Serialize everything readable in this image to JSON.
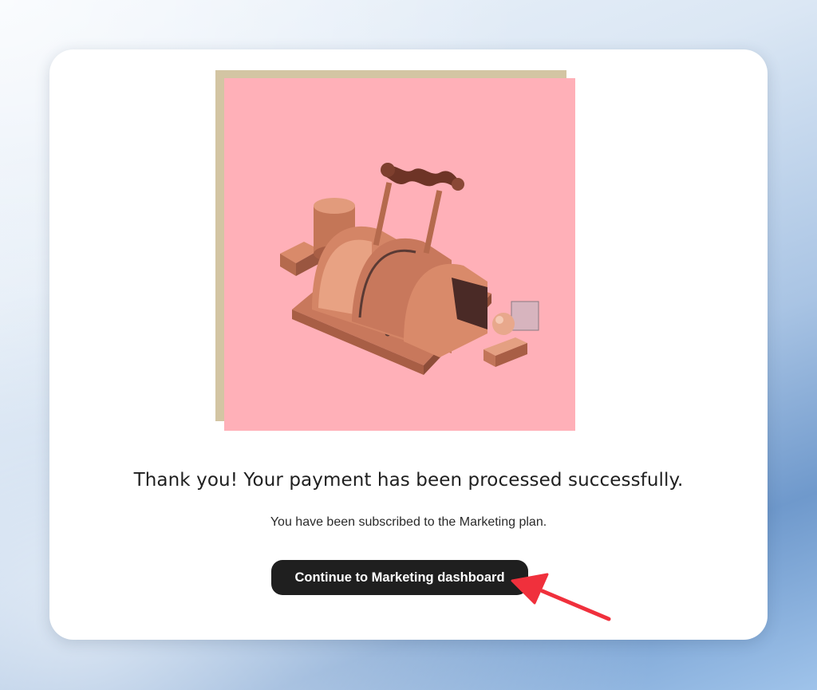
{
  "dialog": {
    "headline": "Thank you! Your payment has been processed successfully.",
    "subtext": "You have been subscribed to the Marketing plan.",
    "cta_label": "Continue to Marketing dashboard"
  },
  "illustration": {
    "subject": "wooden-lever-control-machine",
    "background_color": "#ffb0b8",
    "frame_color": "#d3c5a3"
  },
  "annotation": {
    "icon": "red-pointer-arrow",
    "color": "#f0303c"
  },
  "colors": {
    "card": "#ffffff",
    "button": "#1f1f1f",
    "button_text": "#ffffff"
  }
}
